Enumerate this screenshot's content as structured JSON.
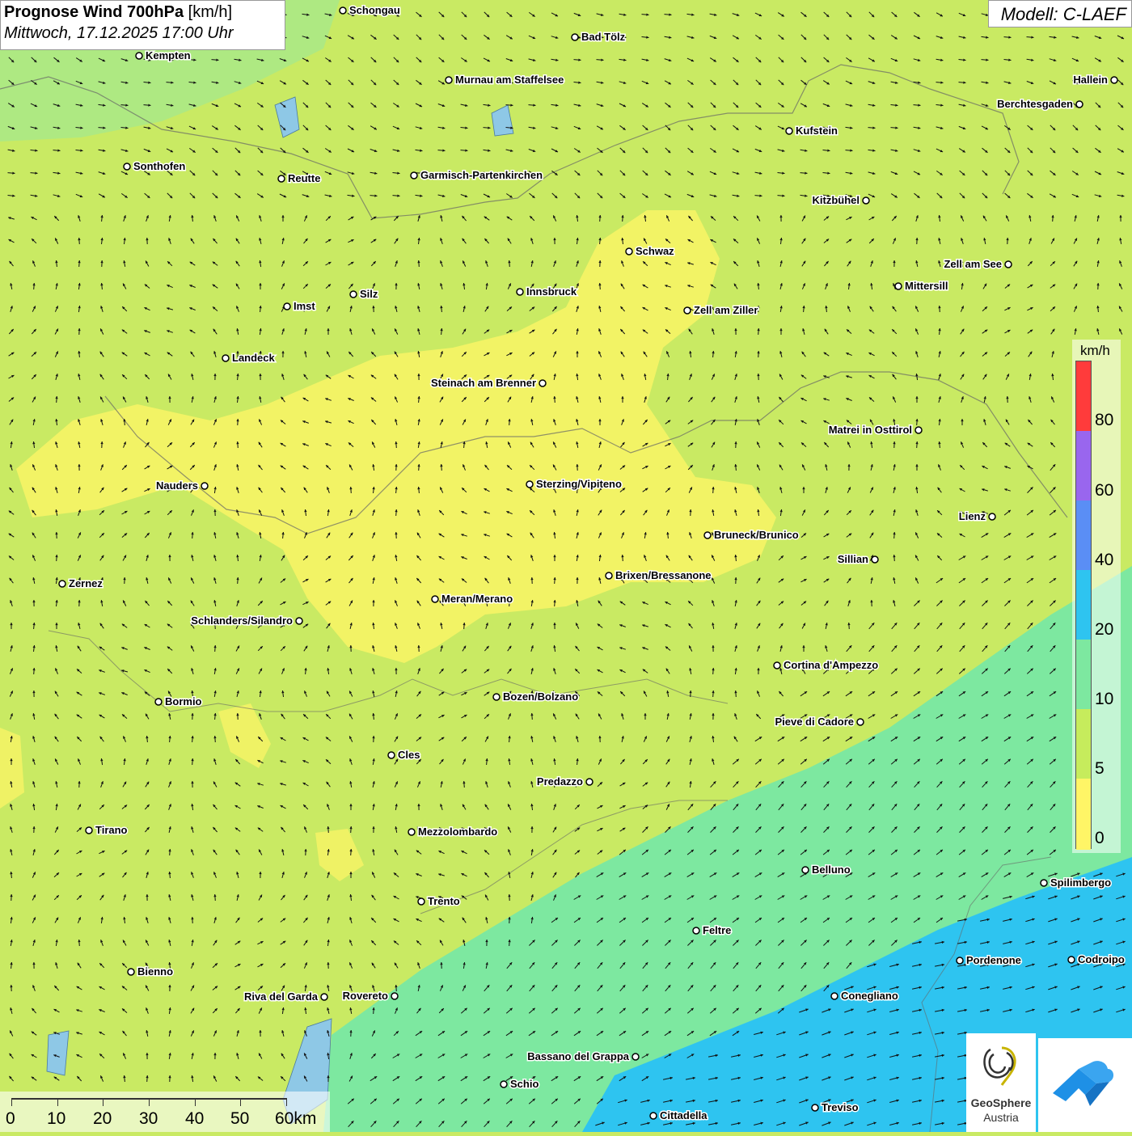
{
  "title": {
    "product": "Prognose Wind 700hPa",
    "unit": "[km/h]",
    "datetime": "Mittwoch, 17.12.2025 17:00 Uhr"
  },
  "model": "Modell: C-LAEF",
  "legend": {
    "unit": "km/h",
    "labels": [
      "80",
      "60",
      "40",
      "20",
      "10",
      "5",
      "0"
    ],
    "colors": [
      "#ff3b3b",
      "#9966ee",
      "#5a8ef5",
      "#2ec4f0",
      "#7de8a0",
      "#c6ec5c",
      "#fff566"
    ]
  },
  "scalebar": {
    "ticks": [
      "0",
      "10",
      "20",
      "30",
      "40",
      "50",
      "60km"
    ]
  },
  "logo": {
    "name": "GeoSphere",
    "country": "Austria"
  },
  "cities": [
    {
      "name": "Schongau"
    },
    {
      "name": "Bad Tölz"
    },
    {
      "name": "Kempten"
    },
    {
      "name": "Murnau am Staffelsee"
    },
    {
      "name": "Hallein"
    },
    {
      "name": "Berchtesgaden"
    },
    {
      "name": "Kufstein"
    },
    {
      "name": "Sonthofen"
    },
    {
      "name": "Reutte"
    },
    {
      "name": "Garmisch-Partenkirchen"
    },
    {
      "name": "Kitzbühel"
    },
    {
      "name": "Schwaz"
    },
    {
      "name": "Zell am See"
    },
    {
      "name": "Mittersill"
    },
    {
      "name": "Innsbruck"
    },
    {
      "name": "Silz"
    },
    {
      "name": "Imst"
    },
    {
      "name": "Zell am Ziller"
    },
    {
      "name": "Landeck"
    },
    {
      "name": "Steinach am Brenner"
    },
    {
      "name": "Matrei in Osttirol"
    },
    {
      "name": "Nauders"
    },
    {
      "name": "Sterzing/Vipiteno"
    },
    {
      "name": "Lienz"
    },
    {
      "name": "Bruneck/Brunico"
    },
    {
      "name": "Sillian"
    },
    {
      "name": "Brixen/Bressanone"
    },
    {
      "name": "Zernez"
    },
    {
      "name": "Meran/Merano"
    },
    {
      "name": "Schlanders/Silandro"
    },
    {
      "name": "Cortina d'Ampezzo"
    },
    {
      "name": "Bozen/Bolzano"
    },
    {
      "name": "Bormio"
    },
    {
      "name": "Pieve di Cadore"
    },
    {
      "name": "Cles"
    },
    {
      "name": "Predazzo"
    },
    {
      "name": "Tirano"
    },
    {
      "name": "Mezzolombardo"
    },
    {
      "name": "Belluno"
    },
    {
      "name": "Spilimbergo"
    },
    {
      "name": "Trento"
    },
    {
      "name": "Feltre"
    },
    {
      "name": "Pordenone"
    },
    {
      "name": "Codroipo"
    },
    {
      "name": "Bienno"
    },
    {
      "name": "Riva del Garda"
    },
    {
      "name": "Rovereto"
    },
    {
      "name": "Conegliano"
    },
    {
      "name": "Bassano del Grappa"
    },
    {
      "name": "Schio"
    },
    {
      "name": "Treviso"
    },
    {
      "name": "Cittadella"
    }
  ]
}
